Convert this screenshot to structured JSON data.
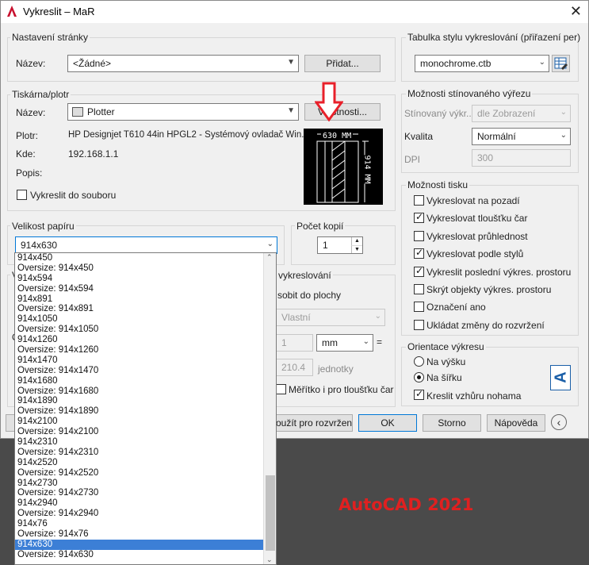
{
  "window": {
    "title": "Vykreslit – MaR"
  },
  "page_setup": {
    "group_label": "Nastavení stránky",
    "name_label": "Název:",
    "name_value": "<Žádné>",
    "add_button": "Přidat..."
  },
  "printer": {
    "group_label": "Tiskárna/plotr",
    "name_label": "Název:",
    "name_value": "Plotter",
    "properties_button": "Vlastnosti...",
    "plotter_label": "Plotr:",
    "plotter_value": "HP Designjet T610 44in HPGL2 - Systémový ovladač Win...",
    "where_label": "Kde:",
    "where_value": "192.168.1.1",
    "desc_label": "Popis:",
    "plot_to_file": "Vykreslit do souboru",
    "preview_width_text": "630 MM",
    "preview_height_text": "914 MM"
  },
  "paper_size": {
    "group_label": "Velikost papíru",
    "selected": "914x630",
    "options": [
      "914x450",
      "Oversize: 914x450",
      "914x594",
      "Oversize: 914x594",
      "914x891",
      "Oversize: 914x891",
      "914x1050",
      "Oversize: 914x1050",
      "914x1260",
      "Oversize: 914x1260",
      "914x1470",
      "Oversize: 914x1470",
      "914x1680",
      "Oversize: 914x1680",
      "914x1890",
      "Oversize: 914x1890",
      "914x2100",
      "Oversize: 914x2100",
      "914x2310",
      "Oversize: 914x2310",
      "914x2520",
      "Oversize: 914x2520",
      "914x2730",
      "Oversize: 914x2730",
      "914x2940",
      "Oversize: 914x2940",
      "914x76",
      "Oversize: 914x76",
      "914x630",
      "Oversize: 914x630"
    ],
    "highlighted_option": "914x630"
  },
  "copies": {
    "group_label": "Počet kopií",
    "value": "1"
  },
  "plot_scale": {
    "group_label_partial": "vykreslování",
    "fit_label": "sobit do plochy",
    "scale_value": "Vlastní",
    "value1": "1",
    "unit": "mm",
    "equals": "=",
    "value2": "210.4",
    "units_label": "jednotky",
    "lineweights": "Měřítko i pro tloušťku čar",
    "left_clip_1": "V",
    "left_clip_2": "O"
  },
  "style_table": {
    "group_label": "Tabulka stylu vykreslování (přiřazení per)",
    "value": "monochrome.ctb"
  },
  "shaded": {
    "group_label": "Možnosti stínovaného výřezu",
    "shade_label": "Stínovaný výkr...",
    "shade_value": "dle Zobrazení",
    "quality_label": "Kvalita",
    "quality_value": "Normální",
    "dpi_label": "DPI",
    "dpi_value": "300"
  },
  "plot_options": {
    "group_label": "Možnosti tisku",
    "items": [
      {
        "label": "Vykreslovat na pozadí",
        "checked": false
      },
      {
        "label": "Vykreslovat tloušťku čar",
        "checked": true
      },
      {
        "label": "Vykreslovat průhlednost",
        "checked": false
      },
      {
        "label": "Vykreslovat podle stylů",
        "checked": true
      },
      {
        "label": "Vykreslit poslední výkres. prostoru",
        "checked": true
      },
      {
        "label": "Skrýt objekty výkres. prostoru",
        "checked": false
      },
      {
        "label": "Označení ano",
        "checked": false
      },
      {
        "label": "Ukládat změny do rozvržení",
        "checked": false
      }
    ]
  },
  "orientation": {
    "group_label": "Orientace výkresu",
    "portrait": "Na výšku",
    "landscape": "Na šířku",
    "upside_down": "Kreslit vzhůru nohama",
    "selected": "landscape",
    "upside_down_checked": true,
    "icon_letter": "A"
  },
  "footer": {
    "apply_button": "oužít pro rozvržení",
    "ok_button": "OK",
    "cancel_button": "Storno",
    "help_button": "Nápověda"
  },
  "watermark": {
    "text": "AutoCAD 2021"
  },
  "annotation_arrow_color": "#e8202a"
}
